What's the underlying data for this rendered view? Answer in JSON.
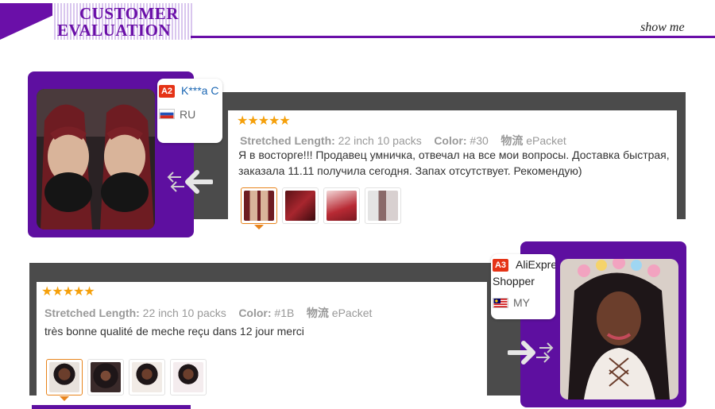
{
  "header": {
    "title_line1": "CUSTOMER",
    "title_line2": "EVALUATION",
    "show_more": "show me",
    "accent_color": "#6a0fa8"
  },
  "reviews": [
    {
      "level_badge": "A2",
      "username": "K***a C",
      "country": "RU",
      "flag": "russia-flag",
      "rating": 5,
      "stars": "★★★★★",
      "length_label": "Stretched Length:",
      "length_value": "22 inch 10 packs",
      "color_label": "Color:",
      "color_value": "#30",
      "shipping_label": "物流",
      "shipping_value": "ePacket",
      "text": "Я в восторге!!! Продавец умничка, отвечал на все мои вопросы. Доставка быстрая, заказала 11.11 получила сегодня. Запах отсутствует. Рекомендую)",
      "thumbnails": [
        "selfie-thumb",
        "braids-thumb",
        "braids-thumb",
        "braids-thumb"
      ]
    },
    {
      "level_badge": "A3",
      "username_line1": "AliExpre",
      "username_line2": "Shopper",
      "country": "MY",
      "flag": "malaysia-flag",
      "rating": 5,
      "stars": "★★★★★",
      "length_label": "Stretched Length:",
      "length_value": "22 inch 10 packs",
      "color_label": "Color:",
      "color_value": "#1B",
      "shipping_label": "物流",
      "shipping_value": "ePacket",
      "text": "très bonne qualité de meche reçu dans 12 jour merci",
      "thumbnails": [
        "selfie-thumb",
        "selfie-thumb",
        "selfie-thumb",
        "selfie-thumb"
      ]
    }
  ]
}
